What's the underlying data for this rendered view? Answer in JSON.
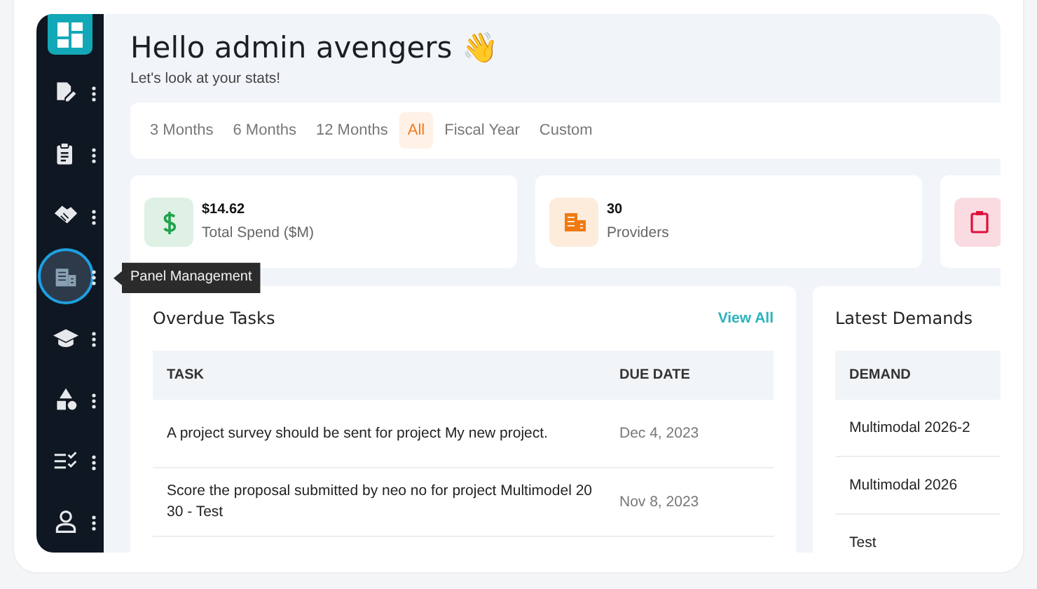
{
  "sidebar": {
    "items": [
      {
        "kind": "edit",
        "selected": false
      },
      {
        "kind": "clipboard",
        "selected": false
      },
      {
        "kind": "handshake",
        "selected": false
      },
      {
        "kind": "building",
        "selected": true,
        "tooltip": "Panel Management"
      },
      {
        "kind": "graduation",
        "selected": false
      },
      {
        "kind": "shapes",
        "selected": false
      },
      {
        "kind": "checklist",
        "selected": false
      },
      {
        "kind": "user",
        "selected": false
      }
    ]
  },
  "header": {
    "title": "Hello admin avengers 👋",
    "subtitle": "Let's look at your stats!"
  },
  "filters": [
    {
      "label": "3 Months",
      "selected": false
    },
    {
      "label": "6 Months",
      "selected": false
    },
    {
      "label": "12 Months",
      "selected": false
    },
    {
      "label": "All",
      "selected": true
    },
    {
      "label": "Fiscal Year",
      "selected": false
    },
    {
      "label": "Custom",
      "selected": false
    }
  ],
  "stats": [
    {
      "kind": "dollar",
      "color": "#1fa34a",
      "value": "$14.62",
      "label": "Total Spend ($M)"
    },
    {
      "kind": "building",
      "color": "#f07a12",
      "value": "30",
      "label": "Providers"
    },
    {
      "kind": "clipboard",
      "color": "#e0103c"
    }
  ],
  "overdue_tasks": {
    "title": "Overdue Tasks",
    "link": "View All",
    "columns": [
      "TASK",
      "DUE DATE"
    ],
    "rows": [
      {
        "task": "A project survey should be sent for project My new project.",
        "due": "Dec 4, 2023"
      },
      {
        "task": "Score the proposal submitted by neo no for project Multimodel 2030 - Test",
        "due": "Nov 8, 2023"
      }
    ]
  },
  "latest_demands": {
    "title": "Latest Demands",
    "columns": [
      "DEMAND"
    ],
    "rows": [
      "Multimodal 2026-2",
      "Multimodal 2026",
      "Test"
    ]
  }
}
